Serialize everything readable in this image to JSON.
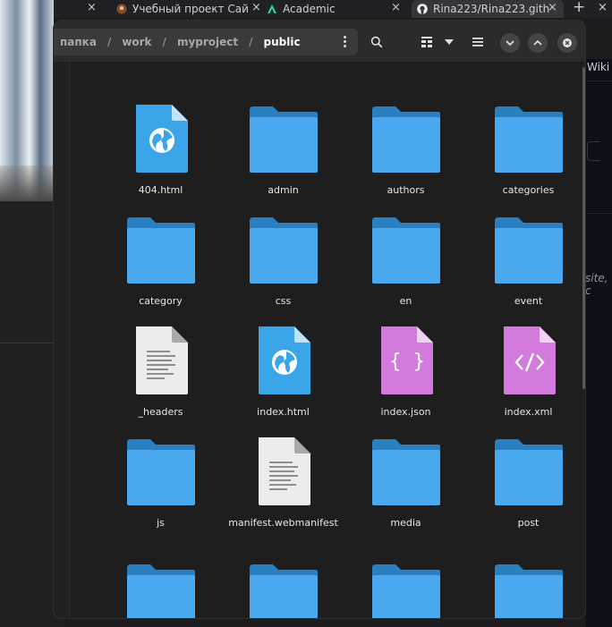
{
  "browser": {
    "tabs": [
      {
        "label": "Учебный проект Сай"
      },
      {
        "label": "Academic"
      },
      {
        "label": "Rina223/Rina223.gith"
      }
    ],
    "new_tab_symbol": "+",
    "close_symbol": "×"
  },
  "background_page": {
    "wiki_link": "Wiki",
    "snippet": "site, c"
  },
  "file_manager": {
    "breadcrumbs": [
      "папка",
      "work",
      "myproject",
      "public"
    ],
    "separator": "/",
    "items": [
      {
        "name": "404.html",
        "type": "html"
      },
      {
        "name": "admin",
        "type": "folder"
      },
      {
        "name": "authors",
        "type": "folder"
      },
      {
        "name": "categories",
        "type": "folder"
      },
      {
        "name": "category",
        "type": "folder"
      },
      {
        "name": "css",
        "type": "folder"
      },
      {
        "name": "en",
        "type": "folder"
      },
      {
        "name": "event",
        "type": "folder"
      },
      {
        "name": "_headers",
        "type": "text"
      },
      {
        "name": "index.html",
        "type": "html"
      },
      {
        "name": "index.json",
        "type": "json"
      },
      {
        "name": "index.xml",
        "type": "xml"
      },
      {
        "name": "js",
        "type": "folder"
      },
      {
        "name": "manifest.webmanifest",
        "type": "text"
      },
      {
        "name": "media",
        "type": "folder"
      },
      {
        "name": "post",
        "type": "folder"
      },
      {
        "name": "",
        "type": "folder"
      },
      {
        "name": "",
        "type": "folder"
      },
      {
        "name": "",
        "type": "folder"
      },
      {
        "name": "",
        "type": "folder"
      }
    ]
  },
  "colors": {
    "folder": "#4aa9ee",
    "folder_tab": "#2a7fc1",
    "html_file": "#3ba5ea",
    "code_file": "#d37bdc",
    "text_file": "#ececec",
    "accent_green": "#3fb950"
  }
}
